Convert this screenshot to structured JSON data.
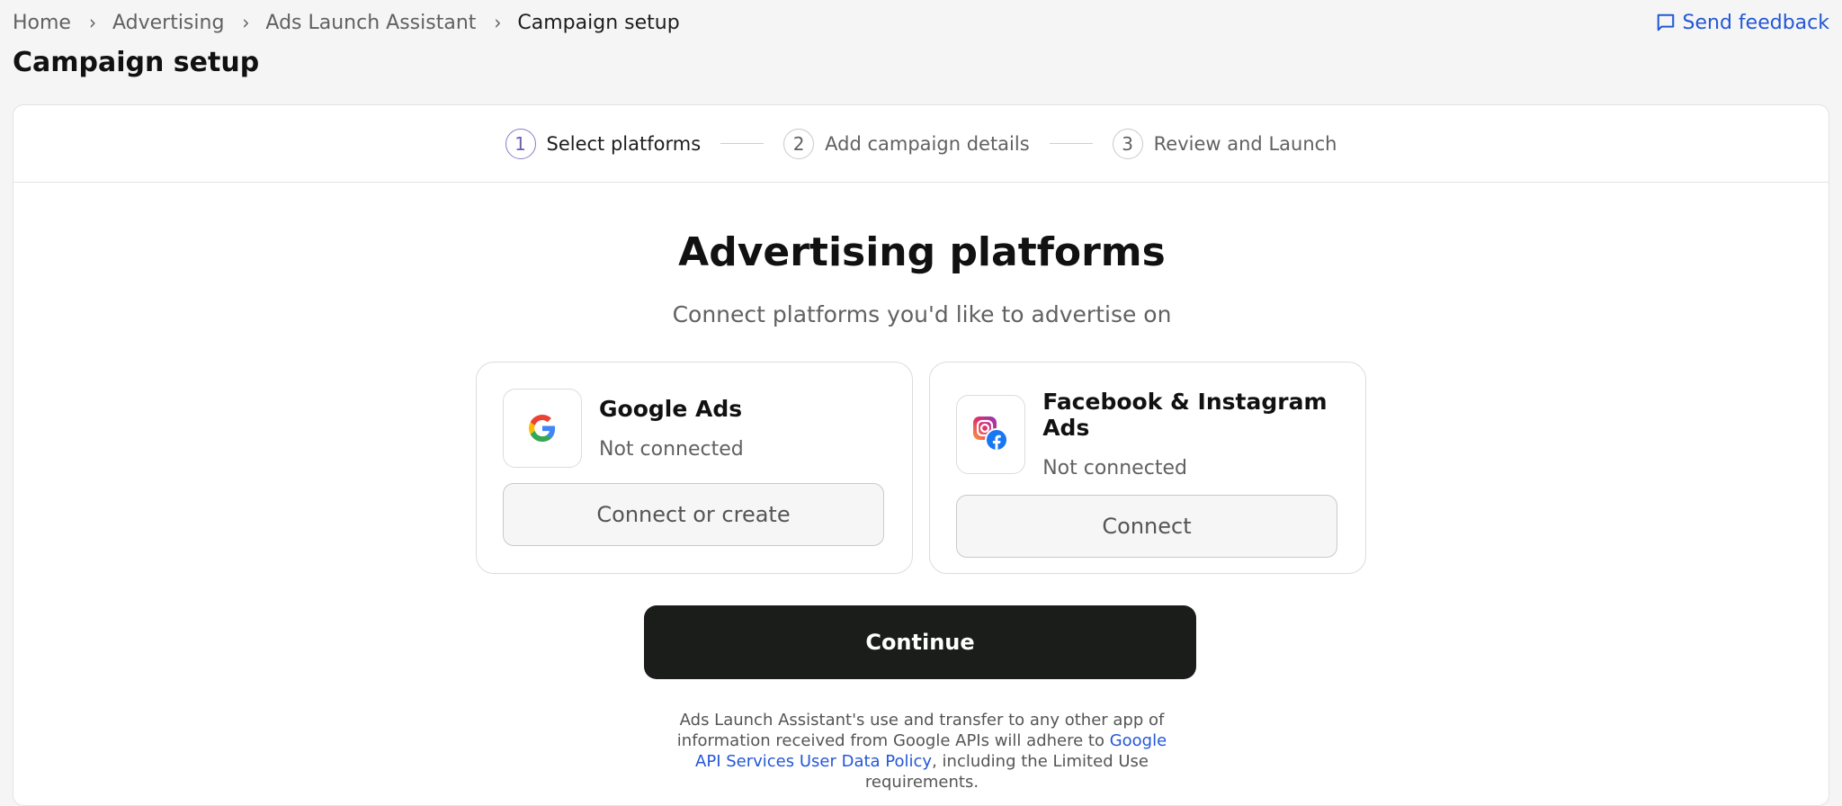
{
  "breadcrumb": {
    "items": [
      "Home",
      "Advertising",
      "Ads Launch Assistant",
      "Campaign setup"
    ]
  },
  "feedback": {
    "label": "Send feedback",
    "icon": "feedback-icon"
  },
  "page": {
    "title": "Campaign setup"
  },
  "stepper": {
    "steps": [
      {
        "number": "1",
        "label": "Select platforms",
        "active": true
      },
      {
        "number": "2",
        "label": "Add campaign details",
        "active": false
      },
      {
        "number": "3",
        "label": "Review and Launch",
        "active": false
      }
    ]
  },
  "main": {
    "heading": "Advertising platforms",
    "subheading": "Connect platforms you'd like to advertise on"
  },
  "platforms": [
    {
      "name": "Google Ads",
      "status": "Not connected",
      "button": "Connect or create",
      "icon": "google-icon"
    },
    {
      "name": "Facebook & Instagram Ads",
      "status": "Not connected",
      "button": "Connect",
      "icon": "meta-icon"
    }
  ],
  "continue_label": "Continue",
  "disclaimer": {
    "text_before": "Ads Launch Assistant's use and transfer to any other app of information received from Google APIs will adhere to ",
    "link": "Google API Services User Data Policy",
    "text_after": ", including the Limited Use requirements."
  },
  "colors": {
    "accent_link": "#2457d6",
    "continue_bg": "#1b1d1a",
    "active_step": "#8a7cc4"
  }
}
